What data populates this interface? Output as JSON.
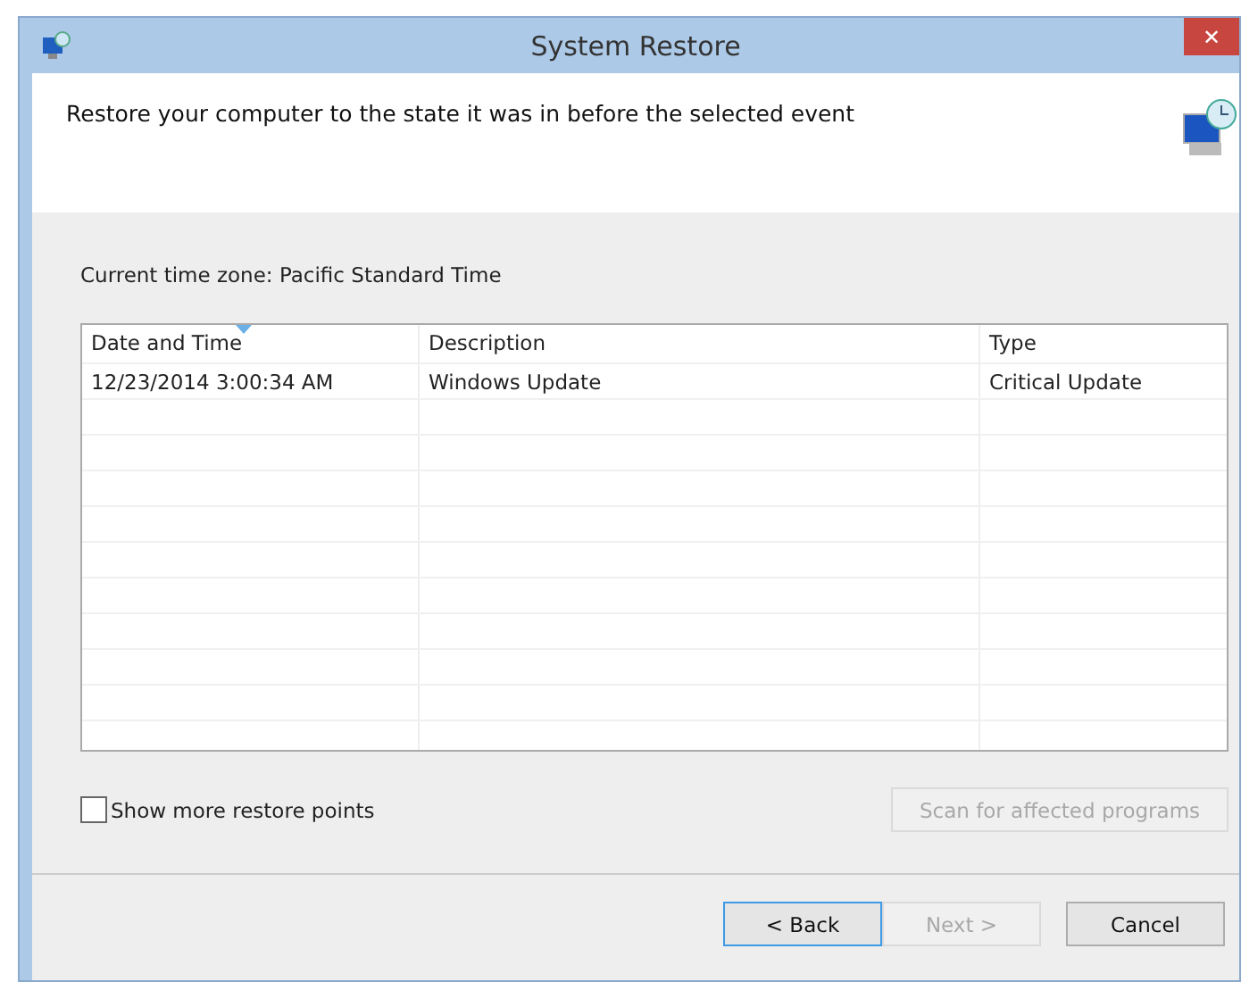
{
  "window": {
    "title": "System Restore",
    "close": "✕"
  },
  "header": {
    "heading": "Restore your computer to the state it was in before the selected event"
  },
  "time_zone": "Current time zone: Pacific Standard Time",
  "table": {
    "columns": [
      {
        "label": "Date and Time",
        "sorted": true
      },
      {
        "label": "Description",
        "sorted": false
      },
      {
        "label": "Type",
        "sorted": false
      }
    ],
    "rows": [
      [
        "12/23/2014 3:00:34 AM",
        "Windows Update",
        "Critical Update"
      ]
    ]
  },
  "show_more": {
    "label": "Show more restore points",
    "checked": false
  },
  "scan_button": {
    "label": "Scan for affected programs",
    "disabled": true
  },
  "buttons": [
    {
      "label": "< Back",
      "disabled": false,
      "focused": true
    },
    {
      "label": "Next >",
      "disabled": true,
      "focused": false
    },
    {
      "label": "Cancel",
      "disabled": false,
      "focused": false
    }
  ]
}
